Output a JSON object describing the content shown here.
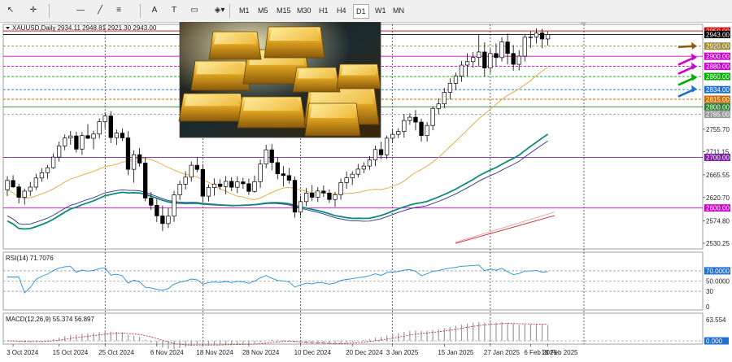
{
  "toolbar": {
    "tools": [
      {
        "name": "cursor-tool",
        "glyph": "↖"
      },
      {
        "name": "crosshair-tool",
        "glyph": "✛"
      },
      {
        "name": "horizontal-line-tool",
        "glyph": "—"
      },
      {
        "name": "trend-line-tool",
        "glyph": "╱"
      },
      {
        "name": "fibonacci-tool",
        "glyph": "≡"
      },
      {
        "name": "text-tool",
        "glyph": "A"
      },
      {
        "name": "label-tool",
        "glyph": "T"
      },
      {
        "name": "rectangle-tool",
        "glyph": "▭"
      },
      {
        "name": "shapes-dropdown",
        "glyph": "◈▾"
      }
    ],
    "timeframes": [
      "M1",
      "M5",
      "M15",
      "M30",
      "H1",
      "H4",
      "D1",
      "W1",
      "MN"
    ],
    "active_timeframe": "D1"
  },
  "chart": {
    "symbol_header": "XAUUSD,Daily  2934.11 2948.81 2921.30 2943.00",
    "price_ticks": [
      {
        "v": 2755.7,
        "t": "2755.70"
      },
      {
        "v": 2711.15,
        "t": "2711.15"
      },
      {
        "v": 2665.55,
        "t": "2665.55"
      },
      {
        "v": 2620.7,
        "t": "2620.70"
      },
      {
        "v": 2574.8,
        "t": "2574.80"
      },
      {
        "v": 2530.25,
        "t": "2530.25"
      }
    ],
    "levels": [
      {
        "v": 2950,
        "t": "2950.00",
        "color": "#cc0000",
        "line": "solid"
      },
      {
        "v": 2943,
        "t": "2943.00",
        "color": "#000000",
        "line": "solid"
      },
      {
        "v": 2920,
        "t": "2920.00",
        "color": "#9a8a30",
        "line": "dash"
      },
      {
        "v": 2900,
        "t": "2900.00",
        "color": "#cc00cc",
        "line": "solid"
      },
      {
        "v": 2880,
        "t": "2880.00",
        "color": "#cc00cc",
        "line": "dash"
      },
      {
        "v": 2860,
        "t": "2860.00",
        "color": "#00aa00",
        "line": "dash"
      },
      {
        "v": 2834,
        "t": "2834.00",
        "color": "#1f6fd0",
        "line": "dash"
      },
      {
        "v": 2815,
        "t": "2815.00",
        "color": "#d46a00",
        "line": "dash"
      },
      {
        "v": 2800,
        "t": "2800.00",
        "color": "#2e7d32",
        "line": "solid"
      },
      {
        "v": 2785,
        "t": "2785.00",
        "color": "#999999",
        "line": "dash"
      },
      {
        "v": 2700,
        "t": "2700.00",
        "color": "#7a1fa2",
        "line": "solid"
      },
      {
        "v": 2600,
        "t": "2600.00",
        "color": "#cc00cc",
        "line": "solid"
      }
    ],
    "date_labels": [
      "3 Oct 2024",
      "15 Oct 2024",
      "25 Oct 2024",
      "6 Nov 2024",
      "18 Nov 2024",
      "28 Nov 2024",
      "10 Dec 2024",
      "20 Dec 2024",
      "3 Jan 2025",
      "15 Jan 2025",
      "27 Jan 2025",
      "6 Feb 2025",
      "18 Feb 2025"
    ],
    "arrow_colors": [
      "#8b5a14",
      "#cc00cc",
      "#cc00cc",
      "#00aa00",
      "#1f6fd0"
    ]
  },
  "rsi": {
    "header": "RSI(14) 71.7076",
    "ticks": [
      {
        "v": 100,
        "t": ""
      },
      {
        "v": 70,
        "t": "70.0000"
      },
      {
        "v": 50,
        "t": "50.0000"
      },
      {
        "v": 30,
        "t": "30"
      },
      {
        "v": 0,
        "t": "0"
      }
    ]
  },
  "macd": {
    "header": "MACD(12,26,9) 55.374 56.897",
    "ticks": [
      {
        "v": 63.554,
        "t": "63.554"
      },
      {
        "v": 0,
        "t": "0.000"
      }
    ]
  },
  "chart_data": {
    "type": "table",
    "ohlc": [
      [
        2636.1,
        2662.8,
        2623.4,
        2654.4
      ],
      [
        2654.4,
        2665.0,
        2639.2,
        2641.7
      ],
      [
        2641.7,
        2648.1,
        2608.8,
        2621.1
      ],
      [
        2621.1,
        2638.4,
        2606.5,
        2633.3
      ],
      [
        2633.3,
        2651.5,
        2623.7,
        2641.3
      ],
      [
        2641.3,
        2667.7,
        2635.5,
        2659.3
      ],
      [
        2659.3,
        2678.6,
        2651.9,
        2669.7
      ],
      [
        2669.7,
        2685.0,
        2657.8,
        2679.6
      ],
      [
        2679.6,
        2707.7,
        2677.3,
        2700.6
      ],
      [
        2700.6,
        2731.4,
        2691.7,
        2722.5
      ],
      [
        2722.5,
        2745.4,
        2714.1,
        2738.4
      ],
      [
        2738.4,
        2752.3,
        2724.9,
        2742.4
      ],
      [
        2742.4,
        2751.0,
        2709.6,
        2716.4
      ],
      [
        2716.4,
        2750.1,
        2705.1,
        2743.1
      ],
      [
        2743.1,
        2765.8,
        2736.2,
        2737.8
      ],
      [
        2737.8,
        2752.9,
        2716.1,
        2746.2
      ],
      [
        2746.2,
        2777.6,
        2737.2,
        2770.6
      ],
      [
        2770.6,
        2789.2,
        2757.5,
        2781.9
      ],
      [
        2781.9,
        2791.3,
        2728.2,
        2739.2
      ],
      [
        2739.2,
        2755.1,
        2724.5,
        2748.1
      ],
      [
        2748.1,
        2756.8,
        2732.6,
        2738.6
      ],
      [
        2738.6,
        2751.6,
        2664.7,
        2676.4
      ],
      [
        2676.4,
        2714.1,
        2650.0,
        2705.4
      ],
      [
        2705.4,
        2718.6,
        2681.9,
        2688.8
      ],
      [
        2688.8,
        2699.3,
        2613.4,
        2619.6
      ],
      [
        2619.6,
        2631.6,
        2596.3,
        2605.4
      ],
      [
        2605.4,
        2618.1,
        2572.2,
        2584.3
      ],
      [
        2584.3,
        2604.8,
        2554.5,
        2569.1
      ],
      [
        2569.1,
        2599.9,
        2560.4,
        2583.8
      ],
      [
        2583.8,
        2633.9,
        2572.5,
        2625.9
      ],
      [
        2625.9,
        2653.9,
        2615.8,
        2647.1
      ],
      [
        2647.1,
        2672.6,
        2636.6,
        2660.9
      ],
      [
        2660.9,
        2691.9,
        2652.0,
        2684.5
      ],
      [
        2684.5,
        2700.3,
        2670.5,
        2676.2
      ],
      [
        2676.2,
        2686.7,
        2611.1,
        2623.3
      ],
      [
        2623.3,
        2646.7,
        2612.9,
        2640.4
      ],
      [
        2640.4,
        2658.5,
        2624.3,
        2647.3
      ],
      [
        2647.3,
        2656.7,
        2636.6,
        2642.4
      ],
      [
        2642.4,
        2663.0,
        2627.1,
        2652.6
      ],
      [
        2652.6,
        2660.9,
        2633.2,
        2641.0
      ],
      [
        2641.0,
        2662.7,
        2629.2,
        2651.6
      ],
      [
        2651.6,
        2659.8,
        2637.9,
        2647.9
      ],
      [
        2647.9,
        2658.2,
        2625.6,
        2632.8
      ],
      [
        2632.8,
        2664.2,
        2630.0,
        2652.0
      ],
      [
        2652.0,
        2695.6,
        2639.9,
        2686.9
      ],
      [
        2686.9,
        2725.0,
        2678.4,
        2715.0
      ],
      [
        2715.0,
        2726.4,
        2674.4,
        2689.8
      ],
      [
        2689.8,
        2700.1,
        2656.7,
        2667.6
      ],
      [
        2667.6,
        2682.8,
        2642.3,
        2664.1
      ],
      [
        2664.1,
        2679.0,
        2647.8,
        2654.8
      ],
      [
        2654.8,
        2662.4,
        2581.0,
        2591.8
      ],
      [
        2591.8,
        2623.8,
        2584.4,
        2612.6
      ],
      [
        2612.6,
        2639.3,
        2603.5,
        2629.4
      ],
      [
        2629.4,
        2645.4,
        2613.6,
        2621.2
      ],
      [
        2621.2,
        2641.4,
        2611.7,
        2633.5
      ],
      [
        2633.5,
        2644.6,
        2621.4,
        2629.5
      ],
      [
        2629.5,
        2636.6,
        2610.0,
        2616.7
      ],
      [
        2616.7,
        2631.8,
        2602.0,
        2626.3
      ],
      [
        2626.3,
        2658.3,
        2616.4,
        2650.2
      ],
      [
        2650.2,
        2672.4,
        2637.8,
        2659.6
      ],
      [
        2659.6,
        2672.4,
        2645.5,
        2666.7
      ],
      [
        2666.7,
        2687.1,
        2660.2,
        2676.8
      ],
      [
        2676.8,
        2690.4,
        2668.9,
        2682.9
      ],
      [
        2682.9,
        2702.3,
        2675.4,
        2694.8
      ],
      [
        2694.8,
        2723.3,
        2682.7,
        2715.6
      ],
      [
        2715.6,
        2730.7,
        2696.6,
        2705.0
      ],
      [
        2705.0,
        2743.3,
        2696.8,
        2738.0
      ],
      [
        2738.0,
        2755.2,
        2728.9,
        2745.6
      ],
      [
        2745.6,
        2757.7,
        2738.2,
        2751.3
      ],
      [
        2751.3,
        2786.1,
        2739.0,
        2772.9
      ],
      [
        2772.9,
        2787.2,
        2764.6,
        2779.5
      ],
      [
        2779.5,
        2793.6,
        2753.3,
        2769.8
      ],
      [
        2769.8,
        2776.5,
        2730.9,
        2743.1
      ],
      [
        2743.1,
        2769.7,
        2731.3,
        2763.2
      ],
      [
        2763.2,
        2801.0,
        2753.7,
        2796.8
      ],
      [
        2796.8,
        2817.1,
        2785.4,
        2805.8
      ],
      [
        2805.8,
        2837.3,
        2797.4,
        2828.8
      ],
      [
        2828.8,
        2856.6,
        2814.6,
        2846.5
      ],
      [
        2846.5,
        2867.6,
        2833.5,
        2860.8
      ],
      [
        2860.8,
        2890.7,
        2849.5,
        2882.5
      ],
      [
        2882.5,
        2905.9,
        2860.2,
        2889.4
      ],
      [
        2889.4,
        2908.5,
        2877.4,
        2897.6
      ],
      [
        2897.6,
        2942.4,
        2880.0,
        2908.4
      ],
      [
        2908.4,
        2927.4,
        2860.0,
        2876.8
      ],
      [
        2876.8,
        2914.6,
        2867.1,
        2905.4
      ],
      [
        2905.4,
        2925.1,
        2879.7,
        2897.4
      ],
      [
        2897.4,
        2937.6,
        2889.7,
        2928.3
      ],
      [
        2928.3,
        2945.4,
        2884.0,
        2905.5
      ],
      [
        2905.5,
        2922.0,
        2871.5,
        2884.1
      ],
      [
        2884.1,
        2911.9,
        2872.1,
        2900.2
      ],
      [
        2900.2,
        2944.4,
        2889.6,
        2937.7
      ],
      [
        2937.7,
        2949.5,
        2916.3,
        2938.2
      ],
      [
        2938.2,
        2955.4,
        2925.0,
        2946.0
      ],
      [
        2946.0,
        2954.1,
        2916.0,
        2934.1
      ],
      [
        2934.1,
        2948.8,
        2921.3,
        2943.0
      ]
    ]
  }
}
